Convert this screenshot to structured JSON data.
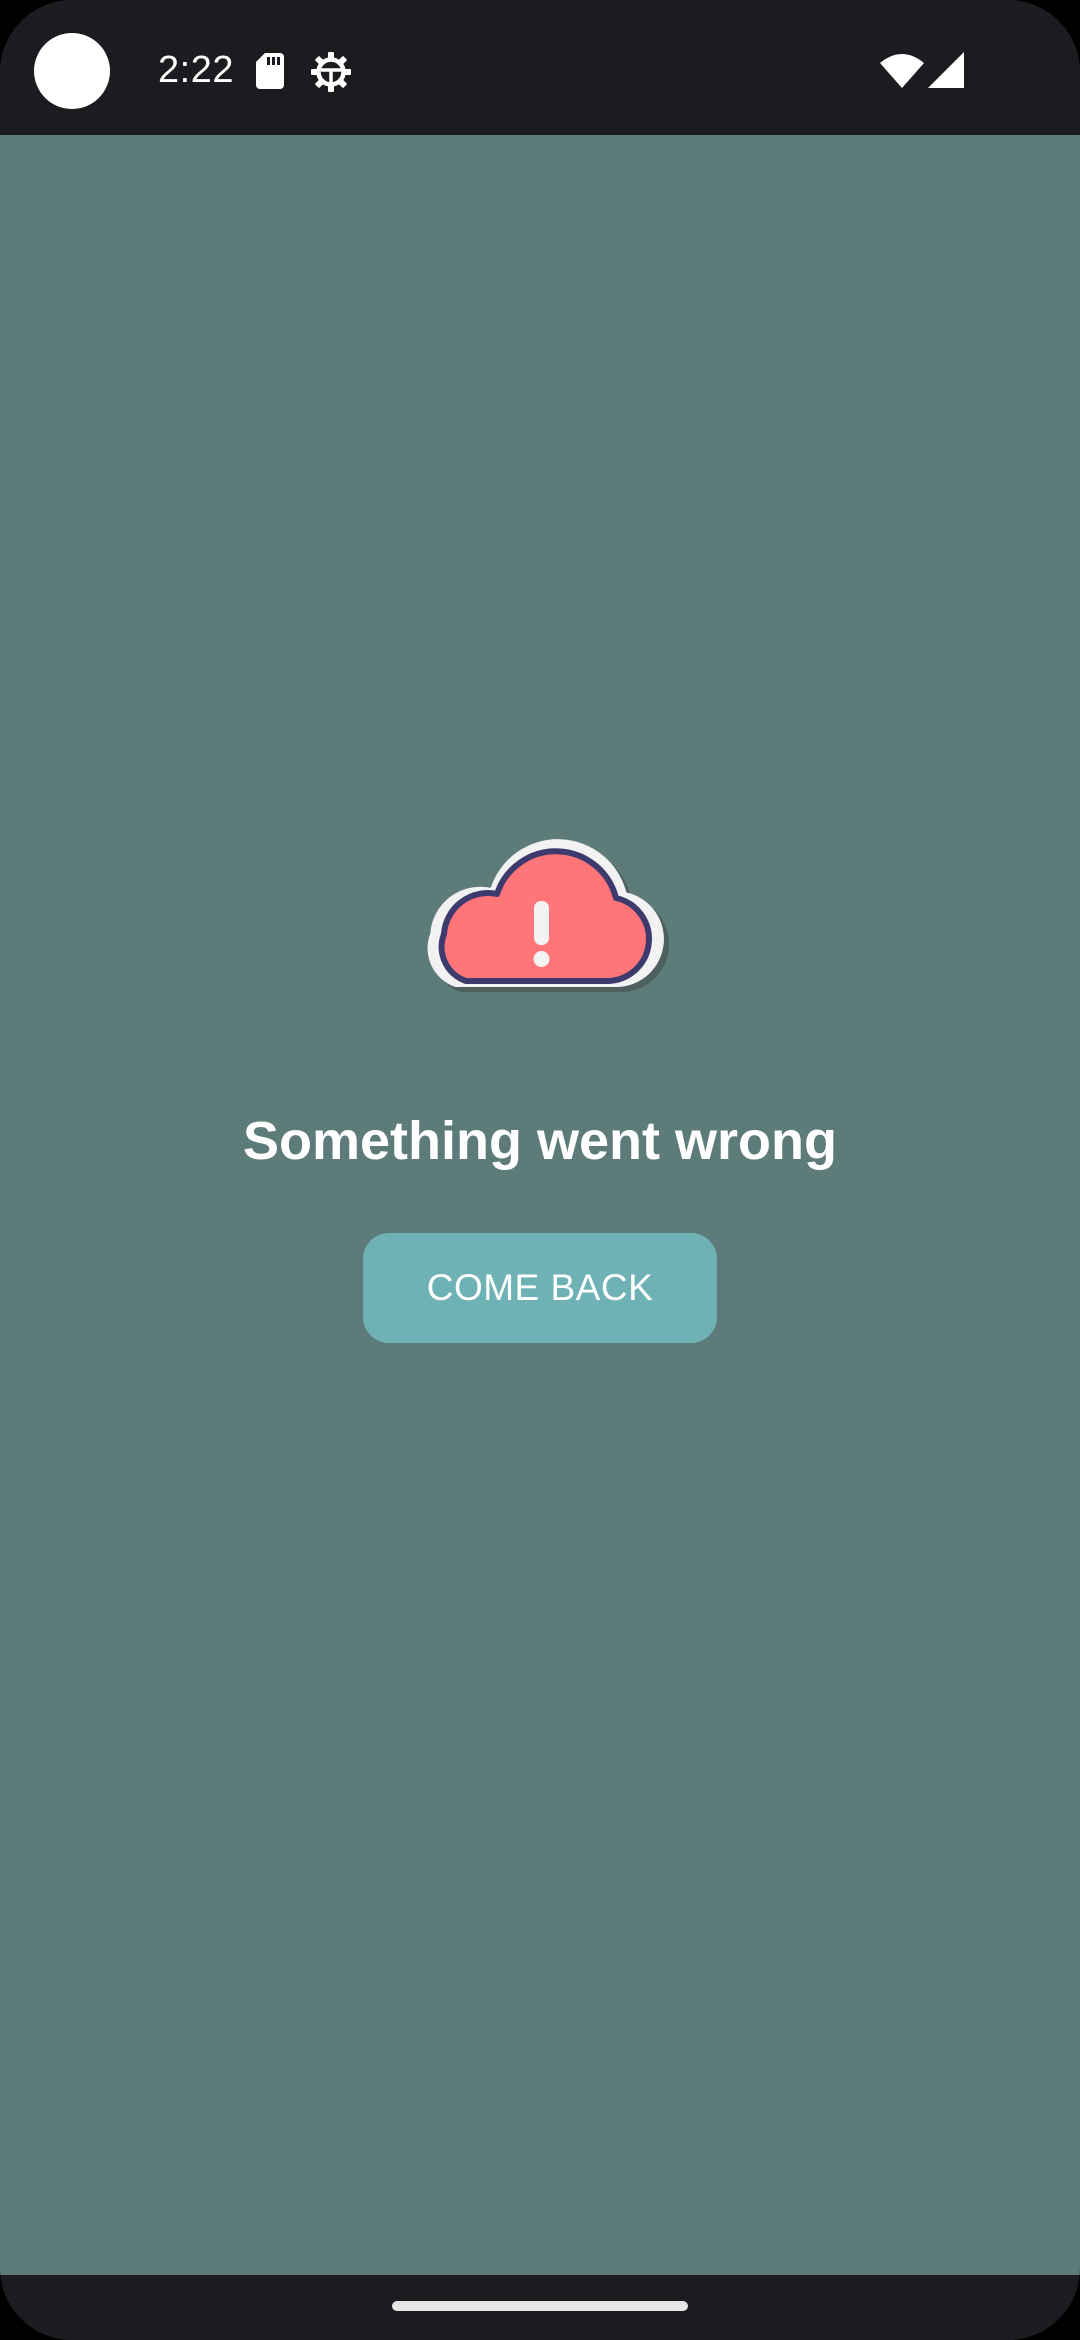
{
  "status_bar": {
    "time": "2:22",
    "icons": [
      "camera-cutout",
      "sd-card-icon",
      "settings-gear-icon",
      "wifi-icon",
      "cell-signal-icon"
    ]
  },
  "error_screen": {
    "illustration": "cloud-error-icon",
    "title": "Something went wrong",
    "button_label": "COME BACK"
  },
  "colors": {
    "background": "#5d7b79",
    "button": "#6fb2b5",
    "system_bars": "#1c1b20",
    "cloud_fill": "#ff7578",
    "cloud_outline": "#3d3a6d"
  },
  "nav_bar": {
    "icons": [
      "home-indicator"
    ]
  }
}
